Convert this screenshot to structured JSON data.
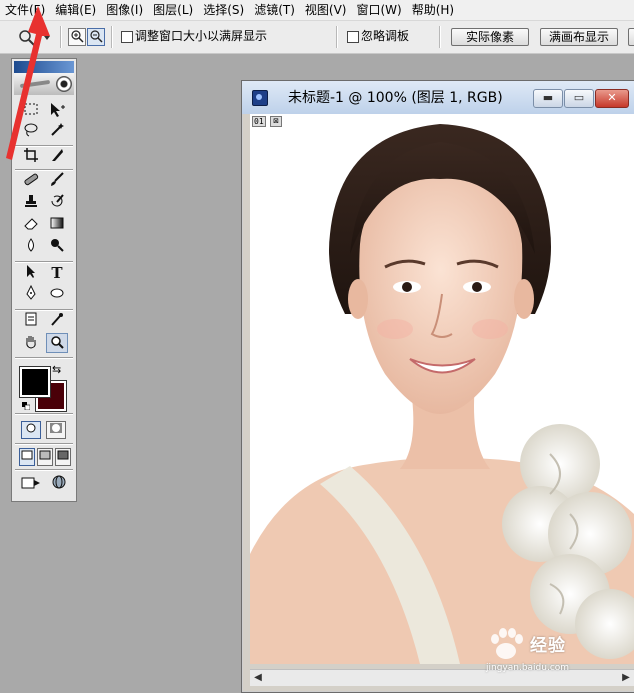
{
  "menubar": {
    "items": [
      "文件(F)",
      "编辑(E)",
      "图像(I)",
      "图层(L)",
      "选择(S)",
      "滤镜(T)",
      "视图(V)",
      "窗口(W)",
      "帮助(H)"
    ]
  },
  "options": {
    "resize_windows_label": "调整窗口大小以满屏显示",
    "ignore_palettes_label": "忽略调板",
    "actual_pixels_label": "实际像素",
    "fit_on_screen_label": "满画布显示",
    "zoom_in_icon": "zoom-in-icon",
    "zoom_out_icon": "zoom-out-icon"
  },
  "toolbox": {
    "foreground_color": "#000000",
    "background_color": "#4a0008"
  },
  "document": {
    "title": "未标题-1 @ 100% (图层 1, RGB)",
    "tag": "01",
    "minimize_icon": "minimize-icon",
    "maximize_icon": "maximize-icon",
    "close_icon": "close-icon"
  },
  "watermark": {
    "text": "经验",
    "sub": "jingyan.baidu.com"
  },
  "colors": {
    "annotation_arrow": "#e8312f",
    "workspace": "#a9a9a9",
    "title_close": "#c6382a"
  }
}
